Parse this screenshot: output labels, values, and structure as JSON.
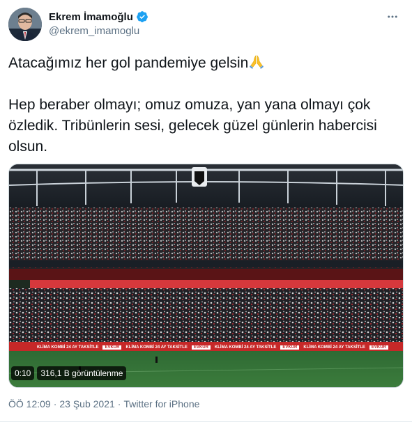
{
  "author": {
    "display_name": "Ekrem İmamoğlu",
    "handle": "@ekrem_imamoglu",
    "verified": true,
    "verified_color": "#1da1f2"
  },
  "tweet": {
    "paragraph1": "Atacağımız her gol pandemiye gelsin",
    "paragraph1_emoji": "folded-hands-emoji",
    "paragraph2": "Hep beraber olmayı; omuz omuza, yan yana olmayı çok özledik. Tribünlerin sesi, gelecek güzel günlerin habercisi olsun."
  },
  "media": {
    "timestamp": "0:10",
    "views": "316,1 B görüntülenme",
    "banners": [
      "KLİMA KOMBİ 24 AY TAKSİTLE",
      "EVKUR",
      "EVKUR",
      "KLİMA KOMBİ 24 AY TAKSİTLE",
      "EVKUR",
      "KLİMA KOMBİ 24 AY TAKSİTLE",
      "EVKUR",
      "KLİMA KOMBİ 24 AY TAKSİTLE",
      "EVKUR"
    ]
  },
  "footer": {
    "time": "ÖÖ 12:09",
    "separator1": "·",
    "date": "23 Şub 2021",
    "separator2": "·",
    "source": "Twitter for iPhone"
  },
  "icons": {
    "more": "more-horizontal-icon",
    "verified": "verified-badge-icon"
  }
}
